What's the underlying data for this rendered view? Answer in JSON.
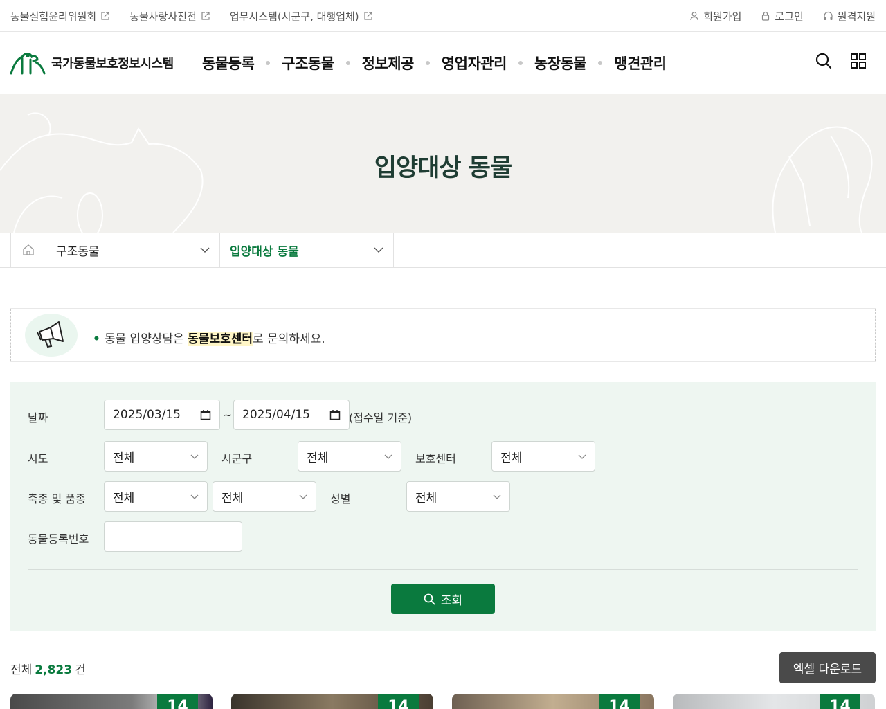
{
  "util": {
    "left_links": [
      {
        "label": "동물실험윤리위원회",
        "icon": "external-link-icon"
      },
      {
        "label": "동물사랑사진전",
        "icon": "external-link-icon"
      },
      {
        "label": "업무시스템(시군구, 대행업체)",
        "icon": "external-link-icon"
      }
    ],
    "right_links": [
      {
        "label": "회원가입",
        "icon": "user-icon"
      },
      {
        "label": "로그인",
        "icon": "lock-icon"
      },
      {
        "label": "원격지원",
        "icon": "headset-icon"
      }
    ]
  },
  "header": {
    "logo_text": "국가동물보호정보시스템",
    "nav": [
      "동물등록",
      "구조동물",
      "정보제공",
      "영업자관리",
      "농장동물",
      "맹견관리"
    ],
    "icons": [
      "search-icon",
      "grid-menu-icon"
    ]
  },
  "banner": {
    "title": "입양대상 동물"
  },
  "breadcrumb": {
    "home_icon": "home-icon",
    "level1": "구조동물",
    "level2": "입양대상 동물"
  },
  "notice": {
    "icon": "megaphone-icon",
    "bullet": "•",
    "text_before": "동물 입양상담은 ",
    "text_bold": "동물보호센터",
    "text_after": "로 문의하세요."
  },
  "search": {
    "date_label": "날짜",
    "date_from": "2025/03/15",
    "date_sep": "~",
    "date_to": "2025/04/15",
    "date_note": "(접수일 기준)",
    "sido_label": "시도",
    "sido_value": "전체",
    "sigungu_label": "시군구",
    "sigungu_value": "전체",
    "center_label": "보호센터",
    "center_value": "전체",
    "species_label": "축종 및 품종",
    "species_value": "전체",
    "breed_value": "전체",
    "sex_label": "성별",
    "sex_value": "전체",
    "regno_label": "동물등록번호",
    "regno_value": "",
    "submit_label": "조회"
  },
  "results": {
    "total_prefix": "전체",
    "total_count": "2,823",
    "total_suffix": "건",
    "excel_label": "엑셀 다운로드",
    "cards": [
      {
        "date": "14",
        "photo_color": "#5a5a5a"
      },
      {
        "date": "14",
        "photo_color": "#7a6a58"
      },
      {
        "date": "14",
        "photo_color": "#a89880"
      },
      {
        "date": "14",
        "photo_color": "#d6d8da"
      }
    ]
  },
  "colors": {
    "brand_green": "#0a7a3e",
    "banner_bg": "#f2f1ee",
    "search_bg": "#eef6f1"
  }
}
